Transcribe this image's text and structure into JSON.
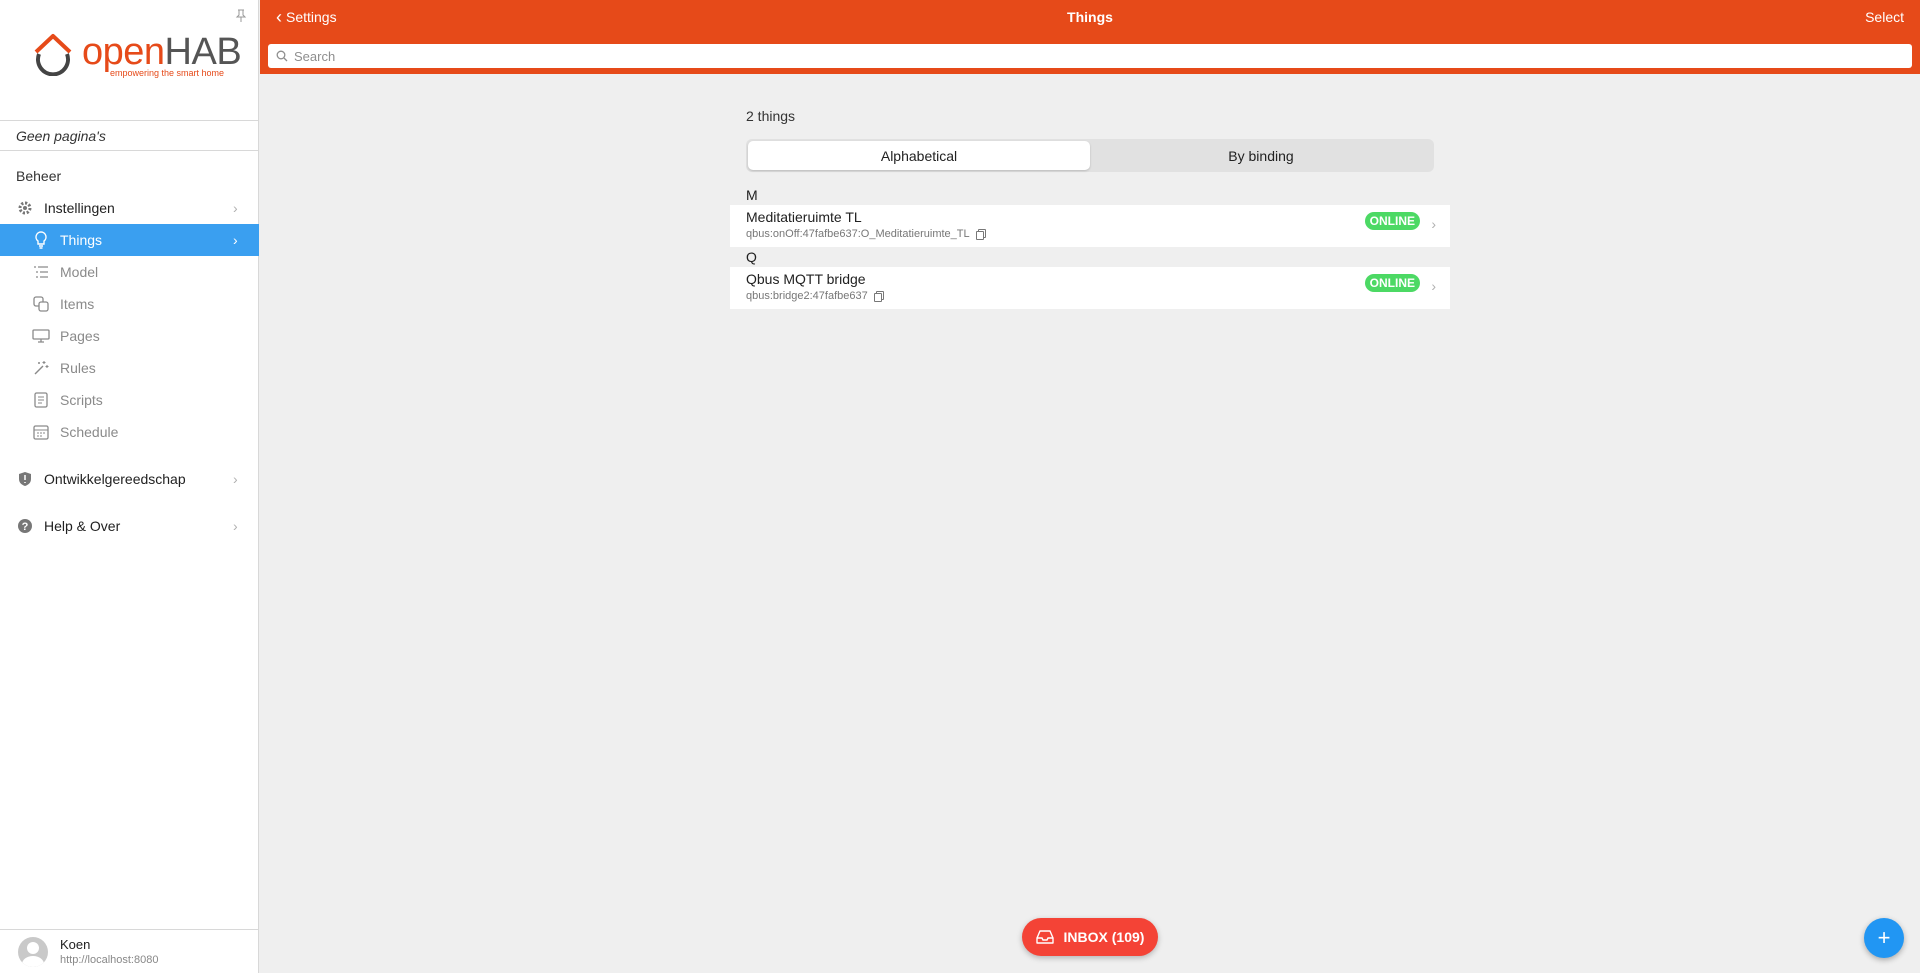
{
  "sidebar": {
    "logo_open": "open",
    "logo_hab": "HAB",
    "logo_tagline": "empowering the smart home",
    "no_pages": "Geen pagina's",
    "section_title": "Beheer",
    "items": [
      {
        "label": "Instellingen",
        "icon": "gear-icon"
      },
      {
        "label": "Things",
        "icon": "lightbulb-icon",
        "active": true
      },
      {
        "label": "Model",
        "icon": "list-icon"
      },
      {
        "label": "Items",
        "icon": "items-icon"
      },
      {
        "label": "Pages",
        "icon": "monitor-icon"
      },
      {
        "label": "Rules",
        "icon": "wand-icon"
      },
      {
        "label": "Scripts",
        "icon": "script-icon"
      },
      {
        "label": "Schedule",
        "icon": "calendar-icon"
      },
      {
        "label": "Ontwikkelgereedschap",
        "icon": "shield-icon"
      },
      {
        "label": "Help & Over",
        "icon": "help-icon"
      }
    ],
    "user": {
      "name": "Koen",
      "url": "http://localhost:8080"
    }
  },
  "header": {
    "back_label": "Settings",
    "title": "Things",
    "select_label": "Select",
    "search_placeholder": "Search"
  },
  "main": {
    "count_label": "2 things",
    "segments": [
      "Alphabetical",
      "By binding"
    ],
    "active_segment": "Alphabetical",
    "groups": [
      {
        "letter": "M",
        "things": [
          {
            "name": "Meditatieruimte TL",
            "uid": "qbus:onOff:47fafbe637:O_Meditatieruimte_TL",
            "status": "ONLINE"
          }
        ]
      },
      {
        "letter": "Q",
        "things": [
          {
            "name": "Qbus MQTT bridge",
            "uid": "qbus:bridge2:47fafbe637",
            "status": "ONLINE"
          }
        ]
      }
    ]
  },
  "inbox_label": "INBOX (109)",
  "fab_label": "+",
  "colors": {
    "header": "#e64a19",
    "active_nav": "#3a9ff0",
    "online": "#4cd964",
    "inbox": "#f44336",
    "fab": "#2196f3"
  }
}
